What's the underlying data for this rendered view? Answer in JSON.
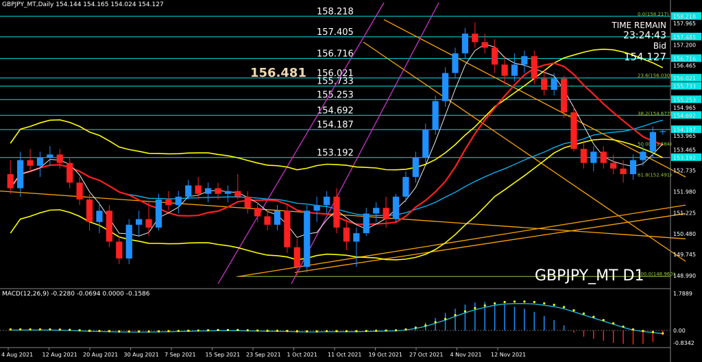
{
  "header": {
    "info": "GBPJPY_MT,Daily  154.144 154.165 154.024 154.127"
  },
  "macd": {
    "label": "MACD(12,26,9) -0.2280 -0.0694 0.0000 -0.1586",
    "ticks": [
      "1.7889",
      "0.00",
      "-0.8342"
    ]
  },
  "timer": {
    "label": "TIME REMAIN",
    "value": "23:24:43",
    "bid_label": "Bid",
    "bid_value": "154.127"
  },
  "symbol": "GBPJPY_MT D1",
  "highlight_price": "156.481",
  "colors": {
    "up": "#1e90ff",
    "down": "#ff2020",
    "grid_line": "#00e5e5",
    "fib": "#9acd32",
    "bands": "#ffff00",
    "trend": "#ffa500",
    "ma_red": "#ff2020",
    "ma_cyan": "#00bfff",
    "channel": "#cc33cc"
  },
  "chart_data": {
    "type": "candlestick",
    "ylim": [
      148.6,
      158.7
    ],
    "y_ticks": [
      "158.218",
      "157.965",
      "157.485",
      "157.200",
      "156.716",
      "156.465",
      "156.021",
      "155.733",
      "155.253",
      "154.965",
      "154.692",
      "154.187",
      "153.965",
      "153.465",
      "153.192",
      "152.735",
      "151.980",
      "151.225",
      "150.480",
      "149.745",
      "148.990"
    ],
    "x_ticks": [
      "4 Aug 2021",
      "12 Aug 2021",
      "20 Aug 2021",
      "30 Aug 2021",
      "7 Sep 2021",
      "15 Sep 2021",
      "23 Sep 2021",
      "1 Oct 2021",
      "11 Oct 2021",
      "19 Oct 2021",
      "27 Oct 2021",
      "4 Nov 2021",
      "12 Nov 2021"
    ],
    "level_lines": [
      {
        "label": "158.218",
        "value": 158.218
      },
      {
        "label": "157.405",
        "value": 157.485
      },
      {
        "label": "156.716",
        "value": 156.716
      },
      {
        "label": "156.021",
        "value": 156.021
      },
      {
        "label": "155.733",
        "value": 155.733
      },
      {
        "label": "155.253",
        "value": 155.253
      },
      {
        "label": "154.692",
        "value": 154.692
      },
      {
        "label": "154.187",
        "value": 154.187
      },
      {
        "label": "153.192",
        "value": 153.192
      }
    ],
    "fib_labels": [
      {
        "label": "0.0(158.217)",
        "value": 158.217
      },
      {
        "label": "23.6(156.030)",
        "value": 156.03
      },
      {
        "label": "38.2(154.677)",
        "value": 154.677
      },
      {
        "label": "50.0(153.584)",
        "value": 153.584
      },
      {
        "label": "61.8(152.491)",
        "value": 152.491
      },
      {
        "label": "100.0(148.960)",
        "value": 148.96
      }
    ],
    "candles": [
      {
        "o": 152.6,
        "h": 153.1,
        "l": 151.9,
        "c": 152.1
      },
      {
        "o": 152.1,
        "h": 153.4,
        "l": 151.8,
        "c": 153.1
      },
      {
        "o": 153.1,
        "h": 153.5,
        "l": 152.7,
        "c": 152.9
      },
      {
        "o": 152.9,
        "h": 153.4,
        "l": 152.5,
        "c": 153.2
      },
      {
        "o": 153.2,
        "h": 153.6,
        "l": 152.9,
        "c": 153.3
      },
      {
        "o": 153.3,
        "h": 153.5,
        "l": 152.8,
        "c": 153.0
      },
      {
        "o": 153.0,
        "h": 153.2,
        "l": 152.1,
        "c": 152.3
      },
      {
        "o": 152.3,
        "h": 152.5,
        "l": 151.5,
        "c": 151.7
      },
      {
        "o": 151.7,
        "h": 151.9,
        "l": 150.6,
        "c": 150.9
      },
      {
        "o": 150.9,
        "h": 151.6,
        "l": 150.5,
        "c": 151.3
      },
      {
        "o": 151.3,
        "h": 151.5,
        "l": 150.0,
        "c": 150.2
      },
      {
        "o": 150.2,
        "h": 150.4,
        "l": 149.4,
        "c": 149.6
      },
      {
        "o": 149.6,
        "h": 151.0,
        "l": 149.4,
        "c": 150.8
      },
      {
        "o": 150.8,
        "h": 151.3,
        "l": 150.4,
        "c": 151.0
      },
      {
        "o": 151.0,
        "h": 151.6,
        "l": 150.4,
        "c": 150.7
      },
      {
        "o": 150.7,
        "h": 151.9,
        "l": 150.6,
        "c": 151.7
      },
      {
        "o": 151.7,
        "h": 152.0,
        "l": 151.3,
        "c": 151.5
      },
      {
        "o": 151.5,
        "h": 152.0,
        "l": 151.2,
        "c": 151.8
      },
      {
        "o": 151.8,
        "h": 152.4,
        "l": 151.7,
        "c": 152.2
      },
      {
        "o": 152.2,
        "h": 152.5,
        "l": 151.7,
        "c": 151.9
      },
      {
        "o": 151.9,
        "h": 152.3,
        "l": 151.6,
        "c": 152.1
      },
      {
        "o": 152.1,
        "h": 152.3,
        "l": 151.7,
        "c": 151.9
      },
      {
        "o": 151.9,
        "h": 152.2,
        "l": 151.6,
        "c": 152.0
      },
      {
        "o": 152.0,
        "h": 152.6,
        "l": 151.7,
        "c": 151.8
      },
      {
        "o": 151.8,
        "h": 152.0,
        "l": 151.2,
        "c": 151.4
      },
      {
        "o": 151.4,
        "h": 151.6,
        "l": 150.9,
        "c": 151.1
      },
      {
        "o": 151.1,
        "h": 151.3,
        "l": 150.6,
        "c": 150.8
      },
      {
        "o": 150.8,
        "h": 151.5,
        "l": 150.6,
        "c": 151.3
      },
      {
        "o": 151.3,
        "h": 151.5,
        "l": 149.8,
        "c": 150.0
      },
      {
        "o": 150.0,
        "h": 150.3,
        "l": 149.0,
        "c": 149.3
      },
      {
        "o": 149.3,
        "h": 151.5,
        "l": 149.1,
        "c": 151.3
      },
      {
        "o": 151.3,
        "h": 151.8,
        "l": 150.9,
        "c": 151.5
      },
      {
        "o": 151.5,
        "h": 152.0,
        "l": 151.2,
        "c": 151.8
      },
      {
        "o": 151.8,
        "h": 152.1,
        "l": 150.5,
        "c": 150.7
      },
      {
        "o": 150.7,
        "h": 151.0,
        "l": 149.9,
        "c": 150.2
      },
      {
        "o": 150.2,
        "h": 150.7,
        "l": 149.3,
        "c": 150.5
      },
      {
        "o": 150.5,
        "h": 151.4,
        "l": 150.4,
        "c": 151.2
      },
      {
        "o": 151.2,
        "h": 151.6,
        "l": 150.9,
        "c": 151.4
      },
      {
        "o": 151.4,
        "h": 151.8,
        "l": 150.7,
        "c": 151.0
      },
      {
        "o": 151.0,
        "h": 151.9,
        "l": 150.9,
        "c": 151.8
      },
      {
        "o": 151.8,
        "h": 152.7,
        "l": 151.6,
        "c": 152.5
      },
      {
        "o": 152.5,
        "h": 153.4,
        "l": 152.3,
        "c": 153.2
      },
      {
        "o": 153.2,
        "h": 154.4,
        "l": 153.0,
        "c": 154.2
      },
      {
        "o": 154.2,
        "h": 155.4,
        "l": 154.0,
        "c": 155.2
      },
      {
        "o": 155.2,
        "h": 156.4,
        "l": 155.0,
        "c": 156.2
      },
      {
        "o": 156.2,
        "h": 157.1,
        "l": 156.0,
        "c": 156.9
      },
      {
        "o": 156.9,
        "h": 157.8,
        "l": 156.7,
        "c": 157.6
      },
      {
        "o": 157.6,
        "h": 158.0,
        "l": 157.1,
        "c": 157.3
      },
      {
        "o": 157.3,
        "h": 157.6,
        "l": 156.9,
        "c": 157.1
      },
      {
        "o": 157.1,
        "h": 157.4,
        "l": 156.2,
        "c": 156.5
      },
      {
        "o": 156.5,
        "h": 156.8,
        "l": 155.8,
        "c": 156.1
      },
      {
        "o": 156.1,
        "h": 156.9,
        "l": 155.9,
        "c": 156.5
      },
      {
        "o": 156.5,
        "h": 157.0,
        "l": 156.2,
        "c": 156.8
      },
      {
        "o": 156.8,
        "h": 157.0,
        "l": 155.8,
        "c": 156.0
      },
      {
        "o": 156.0,
        "h": 156.3,
        "l": 155.4,
        "c": 155.6
      },
      {
        "o": 155.6,
        "h": 156.2,
        "l": 155.4,
        "c": 156.0
      },
      {
        "o": 156.0,
        "h": 156.1,
        "l": 154.6,
        "c": 154.8
      },
      {
        "o": 154.8,
        "h": 155.0,
        "l": 153.4,
        "c": 153.5
      },
      {
        "o": 153.5,
        "h": 153.8,
        "l": 152.8,
        "c": 153.0
      },
      {
        "o": 153.0,
        "h": 153.6,
        "l": 152.7,
        "c": 153.4
      },
      {
        "o": 153.4,
        "h": 153.6,
        "l": 152.8,
        "c": 153.0
      },
      {
        "o": 153.0,
        "h": 153.3,
        "l": 152.6,
        "c": 152.8
      },
      {
        "o": 152.8,
        "h": 153.1,
        "l": 152.3,
        "c": 152.6
      },
      {
        "o": 152.6,
        "h": 153.3,
        "l": 152.4,
        "c": 153.1
      },
      {
        "o": 153.1,
        "h": 153.6,
        "l": 152.9,
        "c": 153.4
      },
      {
        "o": 153.4,
        "h": 154.3,
        "l": 153.2,
        "c": 154.1
      },
      {
        "o": 154.1,
        "h": 154.2,
        "l": 154.0,
        "c": 154.13
      }
    ],
    "macd_hist": [
      0.05,
      0.06,
      0.04,
      0.03,
      0.02,
      0.01,
      -0.02,
      -0.05,
      -0.08,
      -0.06,
      -0.09,
      -0.12,
      -0.08,
      -0.06,
      -0.05,
      -0.03,
      -0.03,
      -0.02,
      0.0,
      0.0,
      0.02,
      0.02,
      0.01,
      0.0,
      -0.03,
      -0.05,
      -0.06,
      -0.04,
      -0.08,
      -0.12,
      -0.05,
      -0.03,
      -0.01,
      -0.05,
      -0.08,
      -0.06,
      -0.02,
      0.0,
      -0.01,
      0.02,
      0.08,
      0.2,
      0.38,
      0.6,
      0.85,
      1.05,
      1.25,
      1.35,
      1.38,
      1.35,
      1.25,
      1.15,
      1.05,
      0.9,
      0.7,
      0.5,
      0.25,
      -0.1,
      -0.3,
      -0.4,
      -0.5,
      -0.6,
      -0.65,
      -0.68,
      -0.65,
      -0.55,
      -0.23
    ],
    "macd_signal": [
      0.02,
      0.02,
      0.02,
      0.02,
      0.02,
      0.01,
      0.0,
      -0.02,
      -0.04,
      -0.05,
      -0.06,
      -0.07,
      -0.08,
      -0.08,
      -0.08,
      -0.07,
      -0.06,
      -0.05,
      -0.04,
      -0.03,
      -0.02,
      -0.01,
      -0.01,
      -0.01,
      -0.02,
      -0.03,
      -0.04,
      -0.04,
      -0.05,
      -0.06,
      -0.07,
      -0.07,
      -0.06,
      -0.06,
      -0.06,
      -0.06,
      -0.05,
      -0.04,
      -0.03,
      -0.02,
      0.02,
      0.1,
      0.2,
      0.35,
      0.5,
      0.68,
      0.85,
      1.0,
      1.12,
      1.22,
      1.28,
      1.3,
      1.3,
      1.28,
      1.22,
      1.15,
      1.05,
      0.9,
      0.75,
      0.6,
      0.45,
      0.3,
      0.15,
      0.02,
      -0.05,
      -0.1,
      -0.16
    ]
  }
}
